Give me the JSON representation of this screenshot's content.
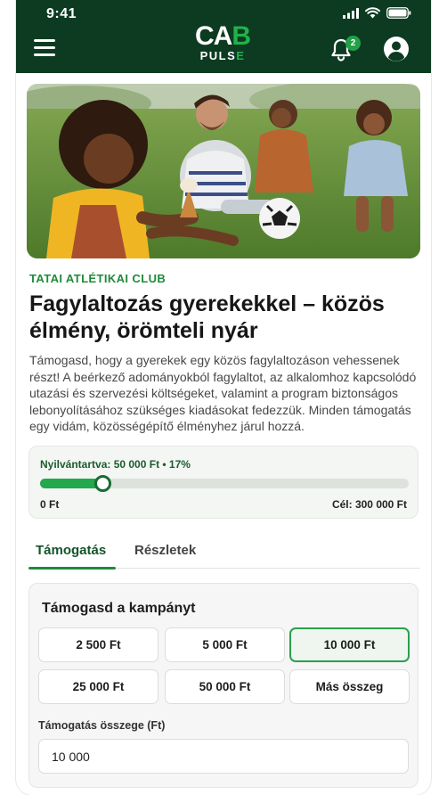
{
  "status_bar": {
    "time": "9:41"
  },
  "app_bar": {
    "logo_top_left": "C",
    "logo_top_right": "B",
    "logo_top_mid": "A",
    "logo_sub_main": "PULS",
    "logo_sub_accent": "E",
    "notification_count": "2"
  },
  "colors": {
    "primary_dark": "#0c3b22",
    "accent_green": "#23a84b"
  },
  "campaign": {
    "club": "TATAI ATLÉTIKAI CLUB",
    "title": "Fagylaltozás gyerekekkel – közös élmény, örömteli nyár",
    "description": "Támogasd, hogy a gyerekek egy közös fagylaltozáson vehessenek részt! A beérkező adományokból fagylaltot, az alkalomhoz kapcsolódó utazási és szervezési költségeket, valamint a program biztonságos lebonyolításához szükséges kiadásokat fedezzük. Minden támogatás egy vidám, közösségépítő élményhez járul hozzá."
  },
  "progress": {
    "registered_label": "Nyilvántartva: 50 000 Ft  • 17%",
    "fraction": 0.17,
    "min_label": "0 Ft",
    "goal_label": "Cél: 300 000 Ft"
  },
  "tabs": [
    {
      "label": "Támogatás",
      "active": true
    },
    {
      "label": "Részletek",
      "active": false
    }
  ],
  "support": {
    "title": "Támogasd a kampányt",
    "amounts": [
      "2 500 Ft",
      "5 000 Ft",
      "10 000 Ft",
      "25 000 Ft",
      "50 000 Ft",
      "Más összeg"
    ],
    "selected_index": 2,
    "field_label": "Támogatás összege (Ft)",
    "field_value": "10 000"
  }
}
